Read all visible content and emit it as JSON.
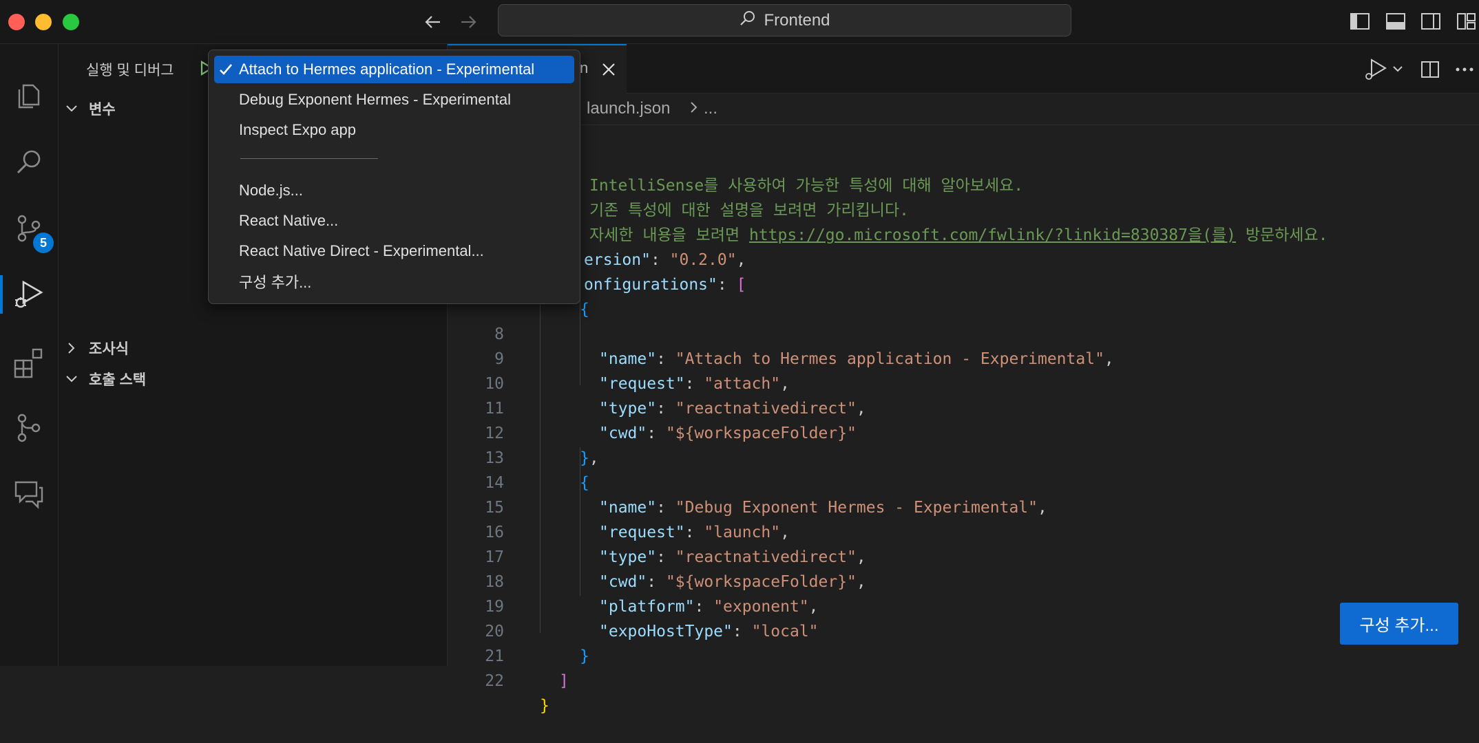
{
  "window": {
    "title": "Frontend"
  },
  "activity_bar": {
    "items": [
      "explorer-icon",
      "search-icon",
      "source-control-icon",
      "run-debug-icon",
      "extensions-icon",
      "git-graph-icon",
      "chat-icon"
    ],
    "scm_badge": "5"
  },
  "sidebar": {
    "title": "실행 및 디버그",
    "sections": {
      "variables": "변수",
      "watch": "조사식",
      "call_stack": "호출 스택"
    }
  },
  "dropdown": {
    "items": [
      {
        "label": "Attach to Hermes application - Experimental",
        "selected": true
      },
      {
        "label": "Debug Exponent Hermes - Experimental"
      },
      {
        "label": "Inspect Expo app"
      },
      {
        "label": "Node.js..."
      },
      {
        "label": "React Native..."
      },
      {
        "label": "React Native Direct - Experimental..."
      },
      {
        "label": "구성 추가..."
      }
    ],
    "separator": "──────────────"
  },
  "editor": {
    "tab_label_fragment": "n",
    "breadcrumb": [
      "launch.json",
      "..."
    ],
    "comments": {
      "c1": "IntelliSense를 사용하여 가능한 특성에 대해 알아보세요.",
      "c2": "기존 특성에 대한 설명을 보려면 가리킵니다.",
      "c3_before": "자세한 내용을 보려면 ",
      "c3_link": "https://go.microsoft.com/fwlink/?linkid=830387",
      "c3_link_suffix": "을(를)",
      "c3_after": " 방문하세요."
    },
    "lines": {
      "version_key": "ersion\"",
      "version_val": "\"0.2.0\"",
      "configs_key": "onfigurations\"",
      "name1": "\"Attach to Hermes application - Experimental\"",
      "request1": "\"attach\"",
      "type1": "\"reactnativedirect\"",
      "cwd1": "\"${workspaceFolder}\"",
      "name2": "\"Debug Exponent Hermes - Experimental\"",
      "request2": "\"launch\"",
      "type2": "\"reactnativedirect\"",
      "cwd2": "\"${workspaceFolder}\"",
      "platform2": "\"exponent\"",
      "expo2": "\"local\""
    },
    "keys": {
      "name": "\"name\"",
      "request": "\"request\"",
      "type": "\"type\"",
      "cwd": "\"cwd\"",
      "platform": "\"platform\"",
      "expoHostType": "\"expoHostType\""
    },
    "line_numbers": [
      "8",
      "9",
      "10",
      "11",
      "12",
      "13",
      "14",
      "15",
      "16",
      "17",
      "18",
      "19",
      "20",
      "21",
      "22"
    ],
    "add_config_button": "구성 추가..."
  }
}
